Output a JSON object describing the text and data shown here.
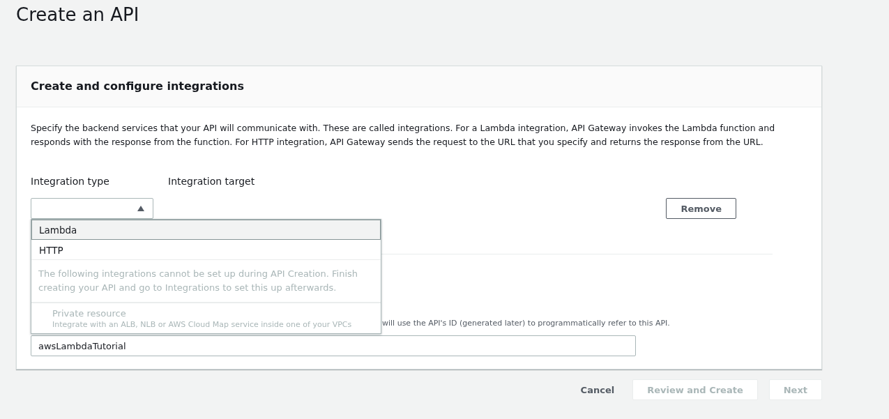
{
  "page_title": "Create an API",
  "card": {
    "title": "Create and configure integrations",
    "description": "Specify the backend services that your API will communicate with. These are called integrations. For a Lambda integration, API Gateway invokes the Lambda function and responds with the response from the function. For HTTP integration, API Gateway sends the request to the URL that you specify and returns the response from the URL.",
    "columns": [
      "Integration type",
      "Integration target"
    ],
    "integration_type_select": {
      "expanded": true,
      "options": [
        {
          "kind": "option",
          "label": "Lambda",
          "selected": true
        },
        {
          "kind": "option",
          "label": "HTTP",
          "selected": false
        },
        {
          "kind": "note",
          "label": "The following integrations cannot be set up during API Creation. Finish creating your API and go to Integrations to set this up afterwards."
        },
        {
          "kind": "disabled",
          "label": "Private resource",
          "description": "Integrate with an ALB, NLB or AWS Cloud Map service inside one of your VPCs"
        }
      ]
    },
    "remove_button": "Remove",
    "api_name_hint": "will use the API's ID (generated later) to programmatically refer to this API.",
    "api_name_value": "awsLambdaTutorial"
  },
  "footer": [
    {
      "label": "Cancel",
      "kind": "link",
      "disabled": false
    },
    {
      "label": "Review and Create",
      "kind": "button",
      "disabled": true
    },
    {
      "label": "Next",
      "kind": "button",
      "disabled": true
    }
  ]
}
